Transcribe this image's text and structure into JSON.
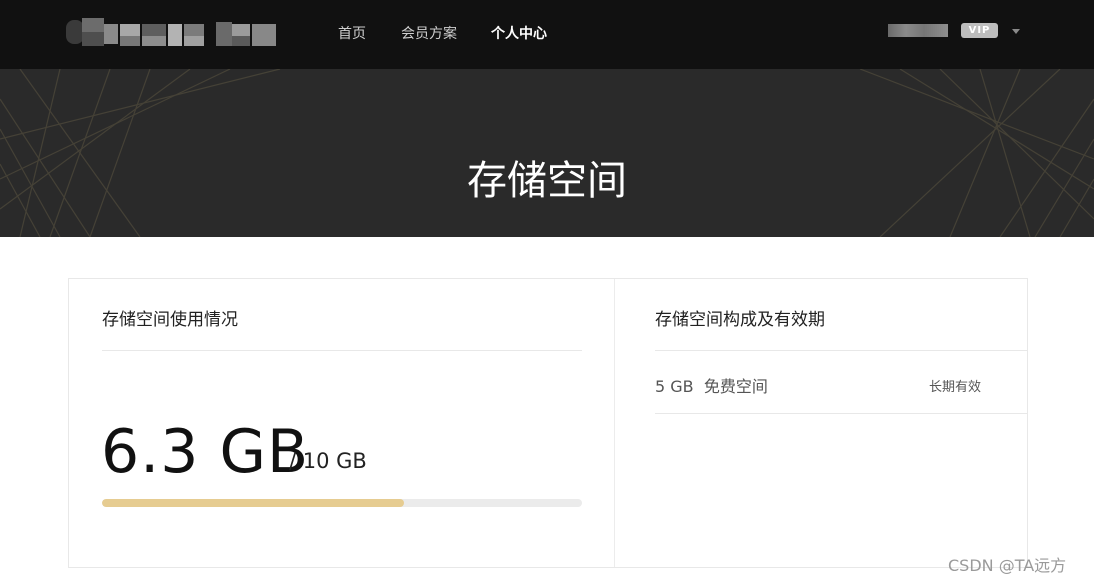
{
  "nav": {
    "items": [
      {
        "label": "首页",
        "active": false
      },
      {
        "label": "会员方案",
        "active": false
      },
      {
        "label": "个人中心",
        "active": true
      }
    ]
  },
  "user": {
    "badge": "VIP"
  },
  "hero": {
    "title": "存储空间"
  },
  "usage": {
    "title": "存储空间使用情况",
    "used": "6.3 GB",
    "total": "/ 10 GB",
    "fraction": 0.63
  },
  "composition": {
    "title": "存储空间构成及有效期",
    "rows": [
      {
        "label": "5 GB  免费空间",
        "validity": "长期有效"
      }
    ]
  },
  "watermark": "CSDN @TA远方",
  "colors": {
    "topbar": "#111111",
    "hero": "#2a2a2a",
    "progress_fill": "#e6cc91",
    "progress_track": "#ebebeb"
  }
}
